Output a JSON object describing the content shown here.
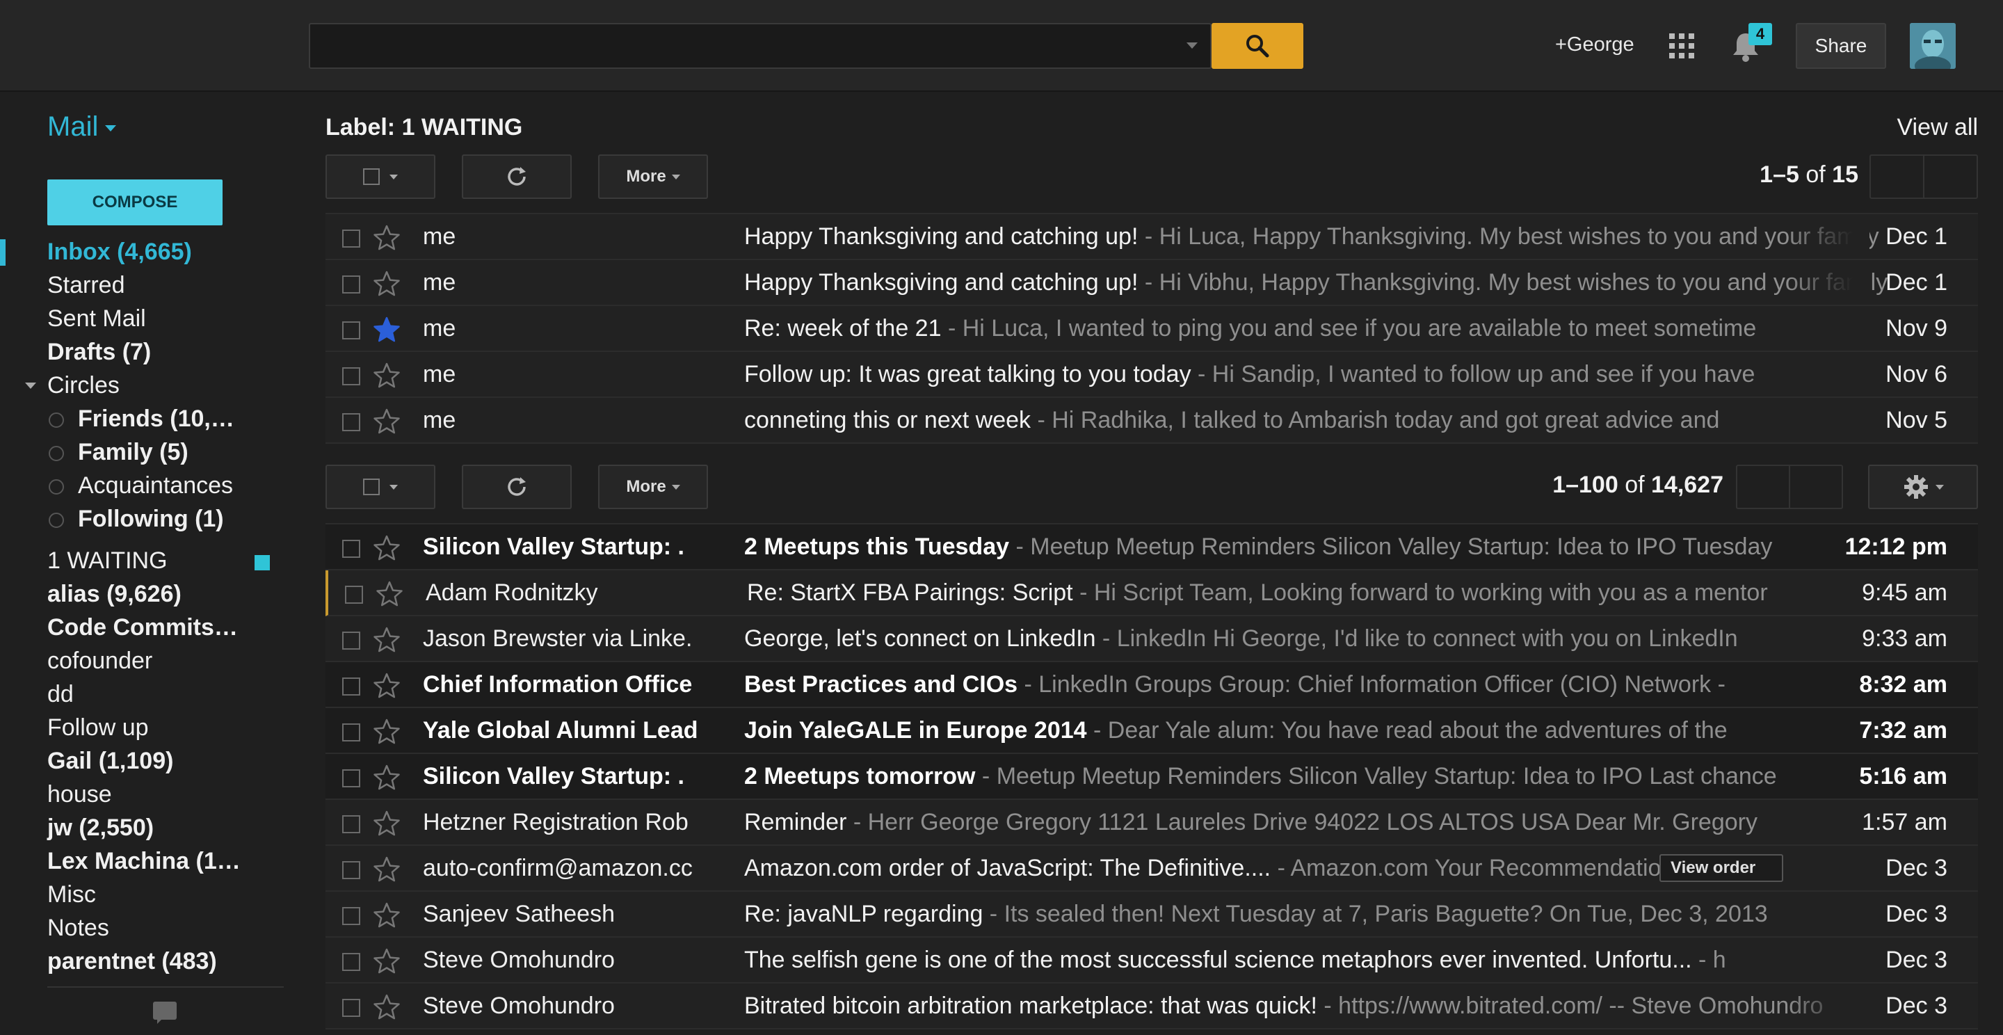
{
  "header": {
    "search_placeholder": "",
    "user_link": "+George",
    "notification_count": "4",
    "share_label": "Share"
  },
  "sidebar": {
    "title": "Mail",
    "compose_label": "COMPOSE",
    "items": [
      {
        "label": "Inbox (4,665)"
      },
      {
        "label": "Starred"
      },
      {
        "label": "Sent Mail"
      },
      {
        "label": "Drafts (7)"
      },
      {
        "label": "Circles"
      },
      {
        "label": "Friends (10,…"
      },
      {
        "label": "Family (5)"
      },
      {
        "label": "Acquaintances"
      },
      {
        "label": "Following (1)"
      },
      {
        "label": "1 WAITING"
      },
      {
        "label": "alias (9,626)"
      },
      {
        "label": "Code Commits…"
      },
      {
        "label": "cofounder"
      },
      {
        "label": "dd"
      },
      {
        "label": "Follow up"
      },
      {
        "label": "Gail (1,109)"
      },
      {
        "label": "house"
      },
      {
        "label": "jw (2,550)"
      },
      {
        "label": "Lex Machina (1…"
      },
      {
        "label": "Misc"
      },
      {
        "label": "Notes"
      },
      {
        "label": "parentnet (483)"
      }
    ]
  },
  "label_section": {
    "title": "Label: 1 WAITING",
    "view_all": "View all",
    "more_label": "More",
    "pager": {
      "range": "1–5",
      "of": "of",
      "total": "15"
    },
    "rows": [
      {
        "sender": "me",
        "subject": "Happy Thanksgiving and catching up!",
        "snippet": " - Hi Luca, Happy Thanksgiving. My best wishes to you and your family",
        "date": "Dec 1",
        "starred": false
      },
      {
        "sender": "me",
        "subject": "Happy Thanksgiving and catching up!",
        "snippet": " - Hi Vibhu, Happy Thanksgiving. My best wishes to you and your family",
        "date": "Dec 1",
        "starred": false
      },
      {
        "sender": "me",
        "subject": "Re: week of the 21",
        "snippet": " - Hi Luca, I wanted to ping you and see if you are available to meet sometime",
        "date": "Nov 9",
        "starred": true
      },
      {
        "sender": "me",
        "subject": "Follow up: It was great talking to you today",
        "snippet": " - Hi Sandip, I wanted to follow up and see if you have",
        "date": "Nov 6",
        "starred": false
      },
      {
        "sender": "me",
        "subject": "conneting this or next week",
        "snippet": " - Hi Radhika, I talked to Ambarish today and got great advice and",
        "date": "Nov 5",
        "starred": false
      }
    ]
  },
  "inbox_section": {
    "more_label": "More",
    "pager": {
      "range": "1–100",
      "of": "of",
      "total": "14,627"
    },
    "view_order_label": "View order",
    "rows": [
      {
        "sender": "Silicon Valley Startup: .",
        "subject": "2 Meetups this Tuesday",
        "snippet": " - Meetup Meetup Reminders Silicon Valley Startup: Idea to IPO Tuesday",
        "date": "12:12 pm",
        "unread": true
      },
      {
        "sender": "Adam Rodnitzky",
        "subject": "Re: StartX FBA Pairings: Script",
        "snippet": " - Hi Script Team, Looking forward to working with you as a mentor",
        "date": "9:45 am",
        "unread": false
      },
      {
        "sender": "Jason Brewster via Linke.",
        "subject": "George, let's connect on LinkedIn",
        "snippet": " - LinkedIn Hi George, I'd like to connect with you on LinkedIn",
        "date": "9:33 am",
        "unread": false
      },
      {
        "sender": "Chief Information Office",
        "subject": "Best Practices and CIOs",
        "snippet": " - LinkedIn Groups Group: Chief Information Officer (CIO) Network - ",
        "date": "8:32 am",
        "unread": true
      },
      {
        "sender": "Yale Global Alumni Lead",
        "subject": "Join YaleGALE in Europe 2014",
        "snippet": " - Dear Yale alum: You have read about the adventures of the",
        "date": "7:32 am",
        "unread": true
      },
      {
        "sender": "Silicon Valley Startup: .",
        "subject": "2 Meetups tomorrow",
        "snippet": " - Meetup Meetup Reminders Silicon Valley Startup: Idea to IPO Last chance",
        "date": "5:16 am",
        "unread": true
      },
      {
        "sender": "Hetzner Registration Rob",
        "subject": "Reminder",
        "snippet": " - Herr George Gregory 1121 Laureles Drive 94022 LOS ALTOS USA Dear Mr. Gregory",
        "date": "1:57 am",
        "unread": false
      },
      {
        "sender": "auto-confirm@amazon.cc",
        "subject": "Amazon.com order of JavaScript: The Definitive....",
        "snippet": " - Amazon.com Your Recommendations",
        "date": "Dec 3",
        "unread": false,
        "has_action": true
      },
      {
        "sender": "Sanjeev Satheesh",
        "subject": "Re: javaNLP regarding",
        "snippet": " - Its sealed then! Next Tuesday at 7, Paris Baguette? On Tue, Dec 3, 2013",
        "date": "Dec 3",
        "unread": false
      },
      {
        "sender": "Steve Omohundro",
        "subject": "The selfish gene is one of the most successful science metaphors ever invented. Unfortu...",
        "snippet": " - h",
        "date": "Dec 3",
        "unread": false
      },
      {
        "sender": "Steve Omohundro",
        "subject": "Bitrated bitcoin arbitration marketplace: that was quick!",
        "snippet": " - https://www.bitrated.com/ -- Steve Omohundro",
        "date": "Dec 3",
        "unread": false
      }
    ]
  },
  "colors": {
    "accent": "#32b8d6",
    "search_button": "#e3a324",
    "star_active": "#2b5fd9",
    "background": "#1f1f1f"
  }
}
